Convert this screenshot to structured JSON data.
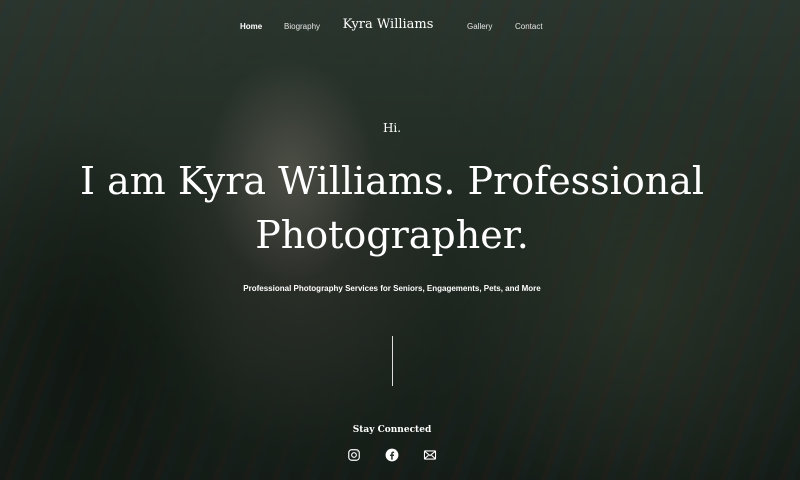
{
  "nav": {
    "left": [
      "Home",
      "Biography"
    ],
    "brand": "Kyra Williams",
    "right": [
      "Gallery",
      "Contact"
    ],
    "active": "Home"
  },
  "hero": {
    "greeting": "Hi.",
    "headline": "I am Kyra Williams. Professional Photographer.",
    "subtitle": "Professional Photography Services for Seniors, Engagements, Pets, and More"
  },
  "social": {
    "heading": "Stay Connected",
    "icons": [
      "instagram-icon",
      "facebook-icon",
      "email-icon"
    ]
  },
  "colors": {
    "text": "#ffffff",
    "overlay": "#2a342c"
  }
}
